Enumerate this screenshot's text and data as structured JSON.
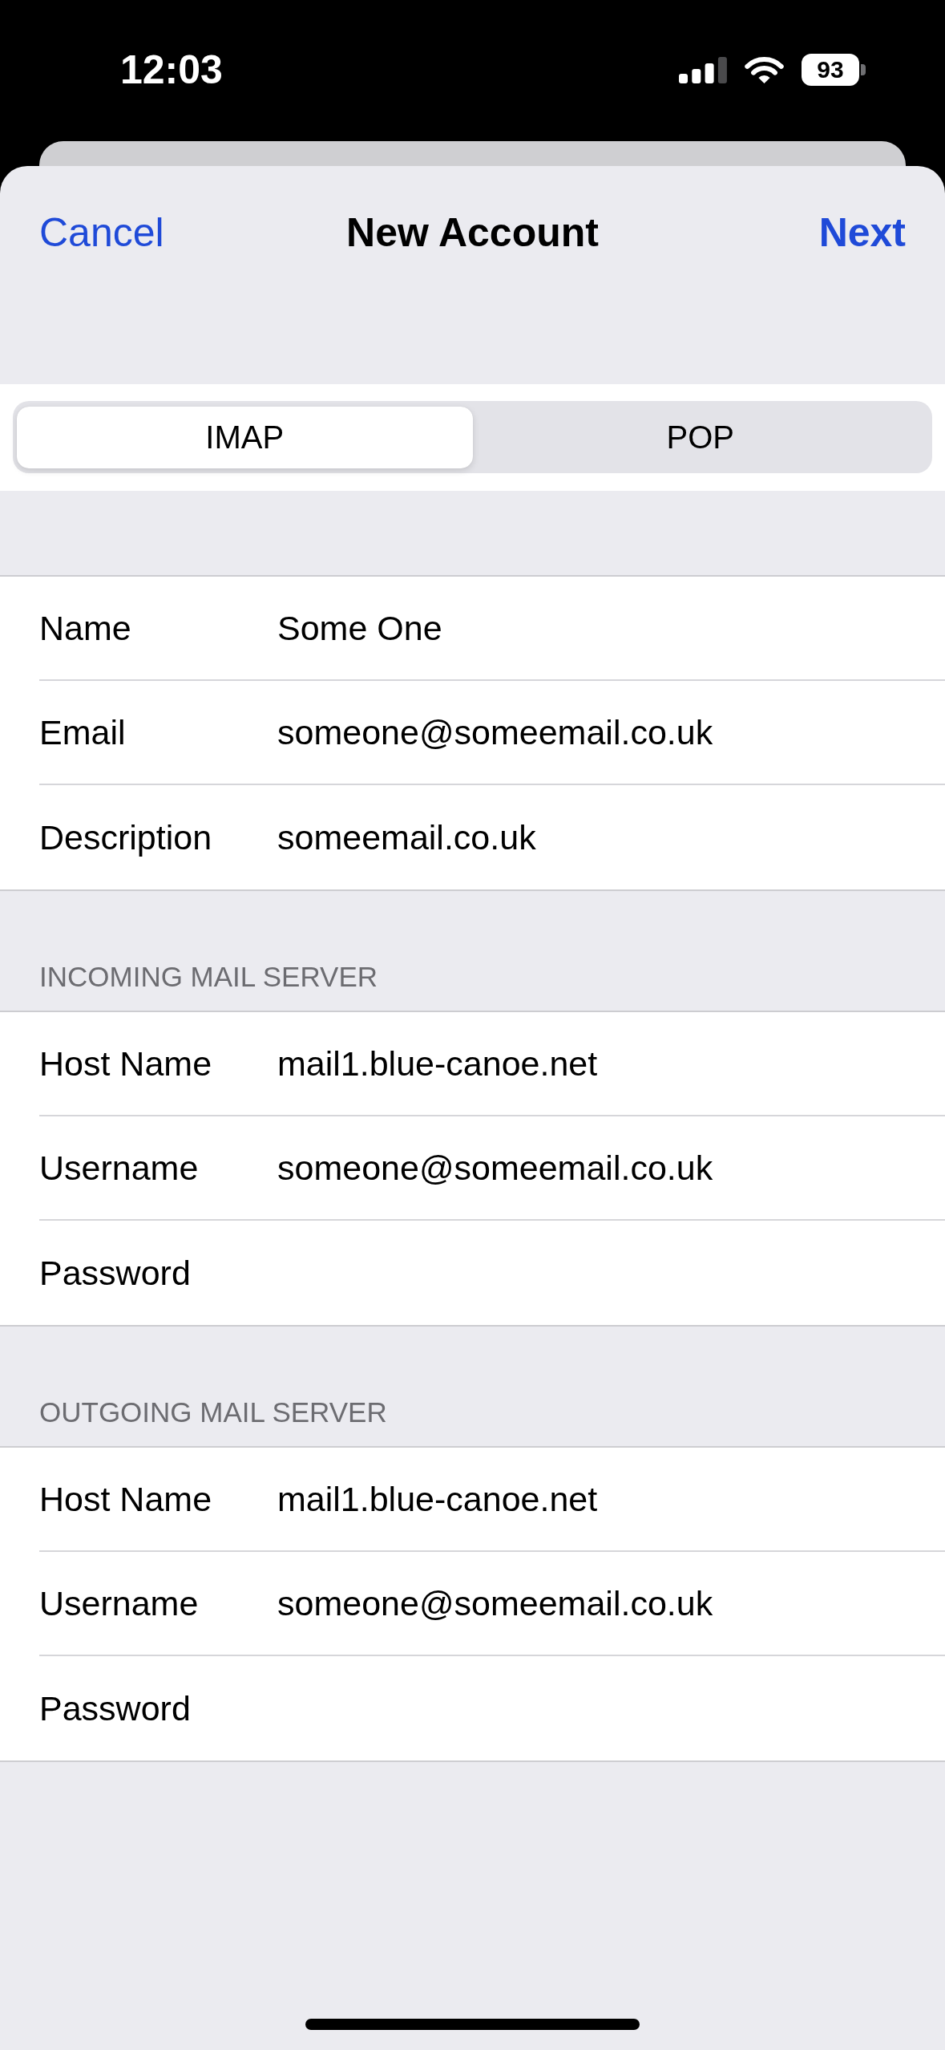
{
  "status_bar": {
    "time": "12:03",
    "battery": "93"
  },
  "nav_bar": {
    "cancel": "Cancel",
    "title": "New Account",
    "next": "Next"
  },
  "account_type": {
    "segments": [
      {
        "label": "IMAP",
        "selected": true
      },
      {
        "label": "POP",
        "selected": false
      }
    ]
  },
  "sections": [
    {
      "rows": [
        {
          "label": "Name",
          "value": "Some One"
        },
        {
          "label": "Email",
          "value": "someone@someemail.co.uk"
        },
        {
          "label": "Description",
          "value": "someemail.co.uk"
        }
      ]
    },
    {
      "header": "INCOMING MAIL SERVER",
      "rows": [
        {
          "label": "Host Name",
          "value": "mail1.blue-canoe.net"
        },
        {
          "label": "Username",
          "value": "someone@someemail.co.uk"
        },
        {
          "label": "Password"
        }
      ]
    },
    {
      "header": "OUTGOING MAIL SERVER",
      "rows": [
        {
          "label": "Host Name",
          "value": "mail1.blue-canoe.net"
        },
        {
          "label": "Username",
          "value": "someone@someemail.co.uk"
        },
        {
          "label": "Password"
        }
      ]
    }
  ]
}
